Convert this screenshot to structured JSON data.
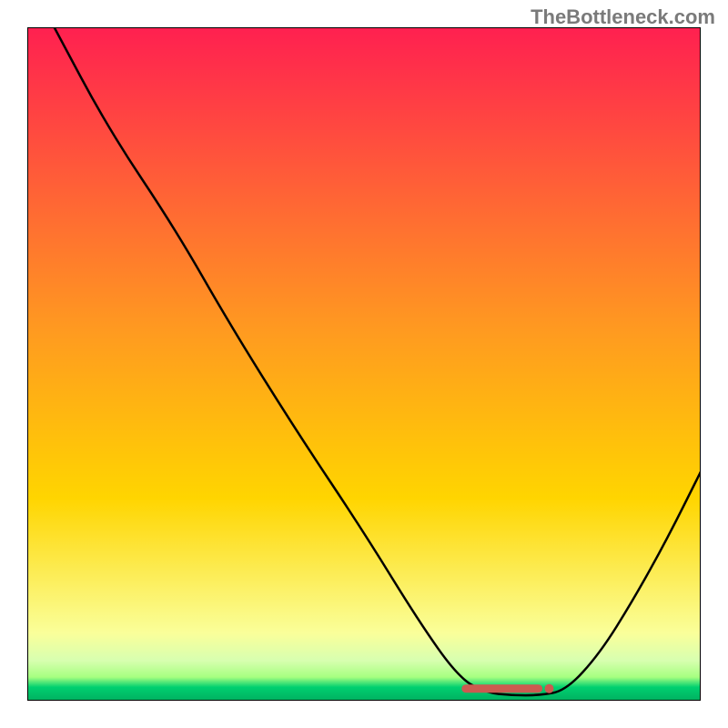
{
  "attribution": "TheBottleneck.com",
  "chart_data": {
    "type": "line",
    "title": "",
    "xlabel": "",
    "ylabel": "",
    "xlim": [
      0,
      100
    ],
    "ylim": [
      0,
      100
    ],
    "background_gradient": {
      "top": "#ff2050",
      "mid": "#ffd500",
      "bottom_band_top": "#faff9a",
      "bottom_band_green1": "#a6ff80",
      "bottom_band_green2": "#00d070",
      "bottom_band_green3": "#00b060"
    },
    "curve": {
      "name": "bottleneck-curve",
      "color": "#000000",
      "points": [
        {
          "x": 4.0,
          "y": 100.0
        },
        {
          "x": 12.0,
          "y": 85.0
        },
        {
          "x": 22.0,
          "y": 70.0
        },
        {
          "x": 30.0,
          "y": 56.0
        },
        {
          "x": 40.0,
          "y": 40.0
        },
        {
          "x": 50.0,
          "y": 25.0
        },
        {
          "x": 58.0,
          "y": 12.0
        },
        {
          "x": 64.0,
          "y": 3.5
        },
        {
          "x": 68.0,
          "y": 1.2
        },
        {
          "x": 72.0,
          "y": 0.8
        },
        {
          "x": 76.0,
          "y": 0.8
        },
        {
          "x": 80.0,
          "y": 1.5
        },
        {
          "x": 85.0,
          "y": 7.0
        },
        {
          "x": 90.0,
          "y": 15.0
        },
        {
          "x": 95.0,
          "y": 24.0
        },
        {
          "x": 100.0,
          "y": 34.0
        }
      ]
    },
    "marker_band": {
      "name": "optimal-range-marker",
      "color": "#cc5a50",
      "x_start": 64.5,
      "x_end": 76.5,
      "y": 1.8,
      "end_dot_x": 77.5
    }
  }
}
